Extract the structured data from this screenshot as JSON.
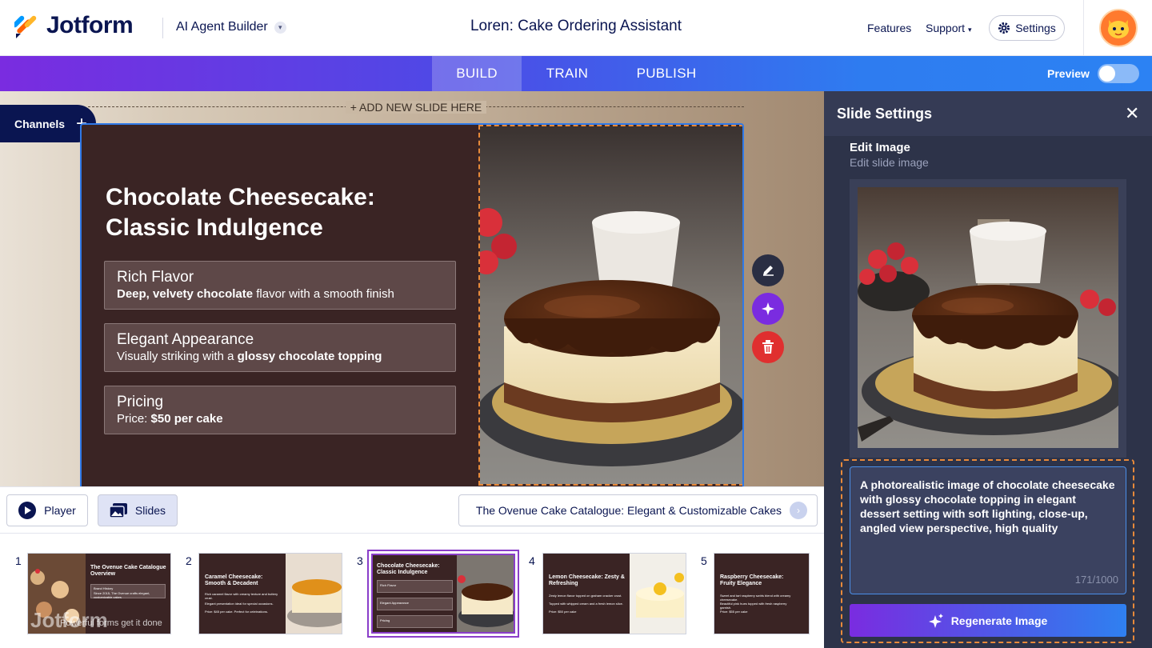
{
  "header": {
    "logo_text": "Jotform",
    "product": "AI Agent Builder",
    "title": "Loren: Cake Ordering Assistant",
    "nav_features": "Features",
    "nav_support": "Support",
    "settings_label": "Settings"
  },
  "tabs": [
    {
      "label": "BUILD",
      "active": true
    },
    {
      "label": "TRAIN",
      "active": false
    },
    {
      "label": "PUBLISH",
      "active": false
    }
  ],
  "preview": {
    "label": "Preview",
    "on": false
  },
  "canvas": {
    "add_slide_label": "+ ADD NEW SLIDE HERE",
    "channels_label": "Channels"
  },
  "slide": {
    "title": "Chocolate Cheesecake: Classic Indulgence",
    "cards": [
      {
        "title": "Rich Flavor",
        "desc_bold": "Deep, velvety chocolate",
        "desc_rest": " flavor with a smooth finish"
      },
      {
        "title": "Elegant Appearance",
        "desc_pre": "Visually striking with a ",
        "desc_bold": "glossy chocolate topping"
      },
      {
        "title": "Pricing",
        "desc_pre": "Price: ",
        "desc_bold": "$50 per cake"
      }
    ]
  },
  "bottom": {
    "player_label": "Player",
    "slides_label": "Slides",
    "catalogue_label": "The Ovenue Cake Catalogue: Elegant & Customizable Cakes"
  },
  "thumbnails": [
    {
      "num": "1",
      "title": "The Ovenue Cake Catalogue Overview",
      "lines": [
        "Brand History",
        "Since 2015, The Ovenue crafts elegant, customizable cakes"
      ],
      "selected": false
    },
    {
      "num": "2",
      "title": "Caramel Cheesecake: Smooth & Decadent",
      "lines": [
        "Rich caramel flavor with creamy texture and buttery crust.",
        "Elegant presentation ideal for special occasions.",
        "Price: $45 per cake. Perfect for celebrations."
      ],
      "selected": false
    },
    {
      "num": "3",
      "title": "Chocolate Cheesecake: Classic Indulgence",
      "lines": [
        "Rich Flavor",
        "Elegant Appearance",
        "Pricing"
      ],
      "selected": true
    },
    {
      "num": "4",
      "title": "Lemon Cheesecake: Zesty & Refreshing",
      "lines": [
        "Zesty lemon flavor topped on graham cracker crust.",
        "Topped with whipped cream and a fresh lemon slice.",
        "Price: $50 per cake"
      ],
      "selected": false
    },
    {
      "num": "5",
      "title": "Raspberry Cheesecake: Fruity Elegance",
      "lines": [
        "Sweet and tart raspberry swirls blend with creamy cheesecake.",
        "Beautiful pink hues topped with fresh raspberry garnish.",
        "Price: $55 per cake"
      ],
      "selected": false
    }
  ],
  "watermark": {
    "brand": "Jotform",
    "tagline": "Powerful forms get it done"
  },
  "panel": {
    "title": "Slide Settings",
    "edit_title": "Edit Image",
    "edit_sub": "Edit slide image",
    "prompt": "A photorealistic image of chocolate cheesecake with glossy chocolate topping in elegant dessert setting with soft lighting, close-up, angled view perspective, high quality",
    "count": "171/1000",
    "regenerate_label": "Regenerate Image"
  },
  "colors": {
    "brand_navy": "#0a1551",
    "slide_bg": "#3a2424",
    "accent_purple": "#7a2ce0",
    "accent_blue": "#2f80f0",
    "delete_red": "#e02f2f",
    "panel_bg": "#2d3349"
  }
}
